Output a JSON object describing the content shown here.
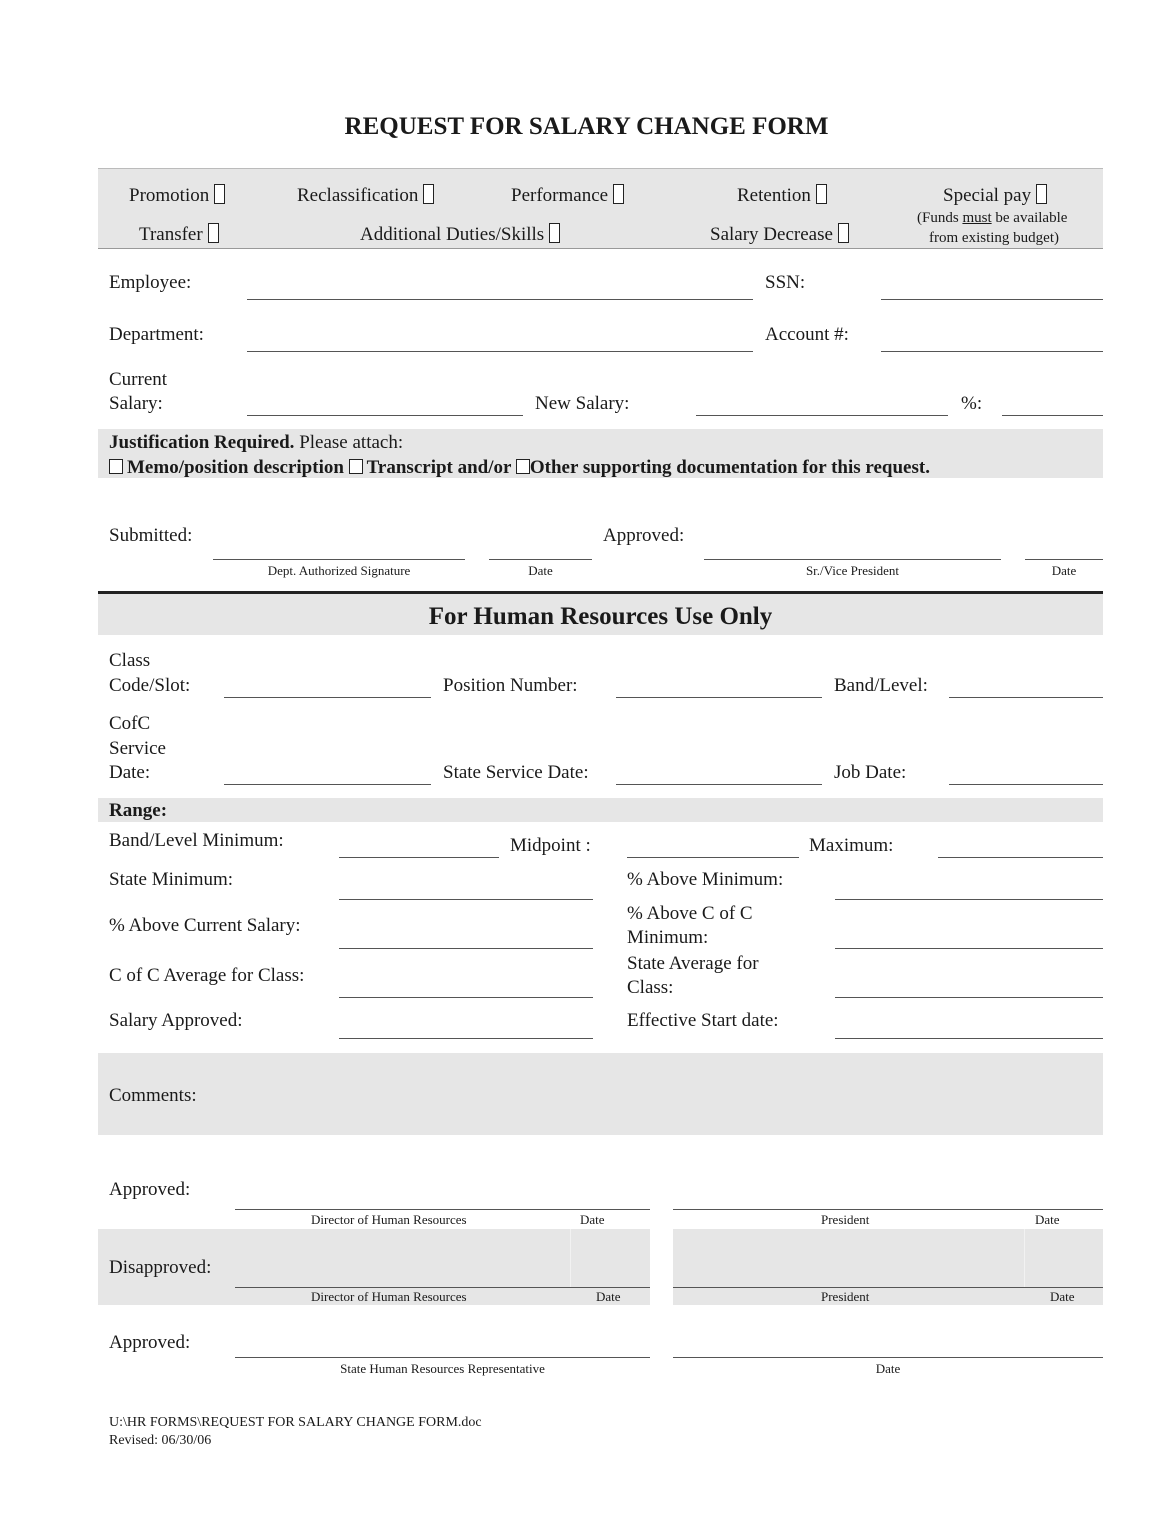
{
  "title": "REQUEST FOR SALARY CHANGE FORM",
  "change_types": {
    "row1": [
      {
        "label": "Promotion",
        "checked": false
      },
      {
        "label": "Reclassification",
        "checked": false
      },
      {
        "label": "Performance",
        "checked": false
      },
      {
        "label": "Retention",
        "checked": false
      },
      {
        "label": "Special pay",
        "checked": false
      }
    ],
    "row2": [
      {
        "label": "Transfer",
        "checked": false
      },
      {
        "label": "Additional Duties/Skills",
        "checked": false
      },
      {
        "label": "Salary Decrease",
        "checked": false
      }
    ],
    "special_pay_note_prefix": "(Funds ",
    "special_pay_note_emphasis": "must",
    "special_pay_note_suffix": " be available",
    "special_pay_note_line2": "from existing budget)"
  },
  "employee_fields": {
    "employee": {
      "label": "Employee:",
      "value": ""
    },
    "ssn": {
      "label": "SSN:",
      "value": ""
    },
    "department": {
      "label": "Department:",
      "value": ""
    },
    "account": {
      "label": "Account #:",
      "value": ""
    },
    "current_salary_line1": "Current",
    "current_salary_line2": "Salary:",
    "current_salary_value": "",
    "new_salary": {
      "label": "New Salary:",
      "value": ""
    },
    "percent": {
      "label": "%:",
      "value": ""
    }
  },
  "justification": {
    "heading": "Justification Required.",
    "attach": " Please attach:",
    "options": [
      {
        "label": "Memo/position description",
        "checked": false
      },
      {
        "label": "Transcript and/or",
        "checked": false
      },
      {
        "label": "Other supporting documentation for this request.",
        "checked": false
      }
    ]
  },
  "submission": {
    "submitted_label": "Submitted:",
    "approved_label": "Approved:",
    "dept_signature_caption": "Dept. Authorized Signature",
    "date_caption": "Date",
    "vp_caption": "Sr./Vice President",
    "vp_date_caption": "Date"
  },
  "hr_section": {
    "title": "For Human Resources Use Only",
    "class_code_line1": "Class",
    "class_code_line2": "Code/Slot:",
    "position_number": "Position Number:",
    "band_level": "Band/Level:",
    "cofc_line1": "CofC",
    "cofc_line2": "Service",
    "cofc_line3": "Date:",
    "state_service_date": "State Service Date:",
    "job_date": "Job Date:"
  },
  "range": {
    "heading": "Range:",
    "band_level_minimum": "Band/Level Minimum:",
    "midpoint": "Midpoint :",
    "maximum": "Maximum:",
    "state_minimum": "State Minimum:",
    "pct_above_minimum": "% Above Minimum:",
    "pct_above_current_salary": "% Above Current Salary:",
    "pct_above_cofc_min_line1": "% Above C of C",
    "pct_above_cofc_min_line2": "Minimum:",
    "cofc_average_for_class": "C of C Average for Class:",
    "state_average_line1": "State Average for",
    "state_average_line2": "Class:",
    "salary_approved": "Salary Approved:",
    "effective_start_date": "Effective Start date:"
  },
  "comments": {
    "label": "Comments:",
    "value": ""
  },
  "approvals": {
    "approved_label": "Approved:",
    "disapproved_label": "Disapproved:",
    "director_caption": "Director of Human Resources",
    "date_caption": "Date",
    "president_caption": "President",
    "state_approved_label": "Approved:",
    "state_rep_caption": "State Human Resources Representative",
    "state_date_caption": "Date"
  },
  "footer": {
    "file_path": "U:\\HR FORMS\\REQUEST FOR SALARY CHANGE FORM.doc",
    "revised": "Revised: 06/30/06"
  }
}
